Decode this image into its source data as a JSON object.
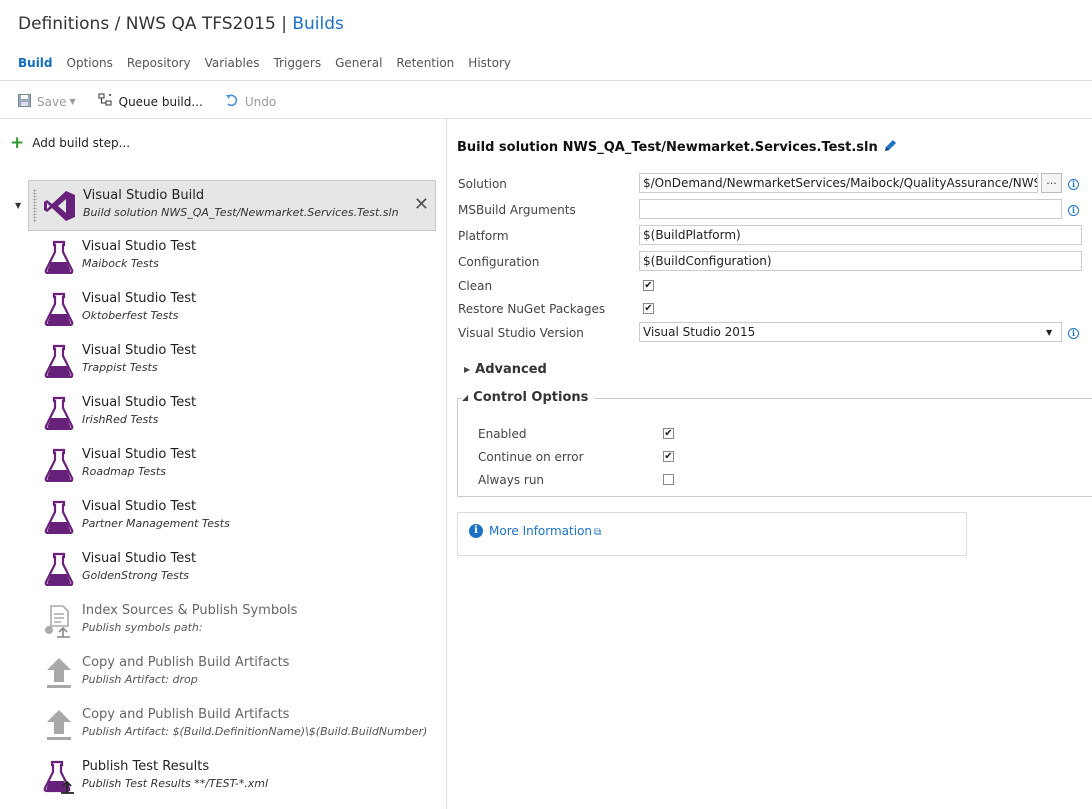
{
  "header": {
    "breadcrumb_prefix": "Definitions",
    "separator1": "/",
    "definition_name": "NWS QA TFS2015",
    "separator2": "|",
    "section": "Builds"
  },
  "tabs": [
    {
      "label": "Build",
      "active": true
    },
    {
      "label": "Options"
    },
    {
      "label": "Repository"
    },
    {
      "label": "Variables"
    },
    {
      "label": "Triggers"
    },
    {
      "label": "General"
    },
    {
      "label": "Retention"
    },
    {
      "label": "History"
    }
  ],
  "toolbar": {
    "save_label": "Save",
    "queue_label": "Queue build...",
    "undo_label": "Undo"
  },
  "add_step_label": "Add build step...",
  "steps": [
    {
      "name": "Visual Studio Build",
      "desc": "Build solution NWS_QA_Test/Newmarket.Services.Test.sln",
      "icon": "visual-studio-icon"
    },
    {
      "name": "Visual Studio Test",
      "desc": "Maibock Tests",
      "icon": "flask-icon"
    },
    {
      "name": "Visual Studio Test",
      "desc": "Oktoberfest Tests",
      "icon": "flask-icon"
    },
    {
      "name": "Visual Studio Test",
      "desc": "Trappist Tests",
      "icon": "flask-icon"
    },
    {
      "name": "Visual Studio Test",
      "desc": "IrishRed Tests",
      "icon": "flask-icon"
    },
    {
      "name": "Visual Studio Test",
      "desc": "Roadmap Tests",
      "icon": "flask-icon"
    },
    {
      "name": "Visual Studio Test",
      "desc": "Partner Management Tests",
      "icon": "flask-icon"
    },
    {
      "name": "Visual Studio Test",
      "desc": "GoldenStrong Tests",
      "icon": "flask-icon"
    },
    {
      "name": "Index Sources & Publish Symbols",
      "desc": "Publish symbols path:",
      "icon": "publish-symbols-icon"
    },
    {
      "name": "Copy and Publish Build Artifacts",
      "desc": "Publish Artifact: drop",
      "icon": "upload-icon"
    },
    {
      "name": "Copy and Publish Build Artifacts",
      "desc": "Publish Artifact: $(Build.DefinitionName)\\$(Build.BuildNumber)",
      "icon": "upload-icon"
    },
    {
      "name": "Publish Test Results",
      "desc": "Publish Test Results **/TEST-*.xml",
      "icon": "flask-upload-icon"
    }
  ],
  "detail": {
    "title": "Build solution NWS_QA_Test/Newmarket.Services.Test.sln",
    "fields": {
      "solution_label": "Solution",
      "solution_value": "$/OnDemand/NewmarketServices/Maibock/QualityAssurance/NWS_QA_Te",
      "browse_label": "...",
      "msbuild_label": "MSBuild Arguments",
      "msbuild_value": "",
      "platform_label": "Platform",
      "platform_value": "$(BuildPlatform)",
      "configuration_label": "Configuration",
      "configuration_value": "$(BuildConfiguration)",
      "clean_label": "Clean",
      "clean_checked": true,
      "restore_label": "Restore NuGet Packages",
      "restore_checked": true,
      "vsversion_label": "Visual Studio Version",
      "vsversion_value": "Visual Studio 2015"
    },
    "advanced_label": "Advanced",
    "control_options_label": "Control Options",
    "control_options": {
      "enabled_label": "Enabled",
      "enabled_checked": true,
      "continue_label": "Continue on error",
      "continue_checked": true,
      "always_label": "Always run",
      "always_checked": false
    },
    "more_info_label": "More Information"
  },
  "colors": {
    "accent": "#1e72c4",
    "vs_purple": "#68217a",
    "add_green": "#339933"
  }
}
